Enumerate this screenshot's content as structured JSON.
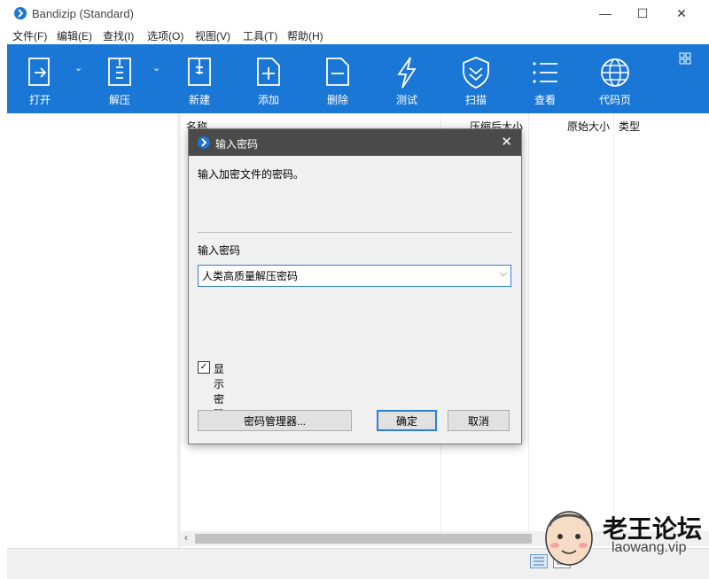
{
  "window": {
    "title": "Bandizip (Standard)",
    "controls": {
      "minimize": "—",
      "maximize": "☐",
      "close": "✕"
    }
  },
  "menubar": [
    "文件(F)",
    "编辑(E)",
    "查找(I)",
    "选项(O)",
    "视图(V)",
    "工具(T)",
    "帮助(H)"
  ],
  "toolbar": {
    "open": "打开",
    "extract": "解压",
    "new": "新建",
    "add": "添加",
    "delete": "删除",
    "test": "测试",
    "scan": "扫描",
    "view": "查看",
    "codepage": "代码页"
  },
  "file_list": {
    "columns": [
      "名称",
      "压缩后大小",
      "原始大小",
      "类型"
    ]
  },
  "dialog": {
    "title": "输入密码",
    "description": "输入加密文件的密码。",
    "password_label": "输入密码",
    "password_value": "人类高质量解压密码",
    "show_password": "显示密码",
    "show_password_checked": true,
    "password_manager_button": "密码管理器...",
    "ok_button": "确定",
    "cancel_button": "取消"
  },
  "watermark": {
    "title": "老王论坛",
    "url": "laowang.vip"
  },
  "colors": {
    "toolbar_bg": "#1b77d5",
    "dialog_title_bg": "#4a4a4a",
    "accent": "#2f7fd4"
  }
}
